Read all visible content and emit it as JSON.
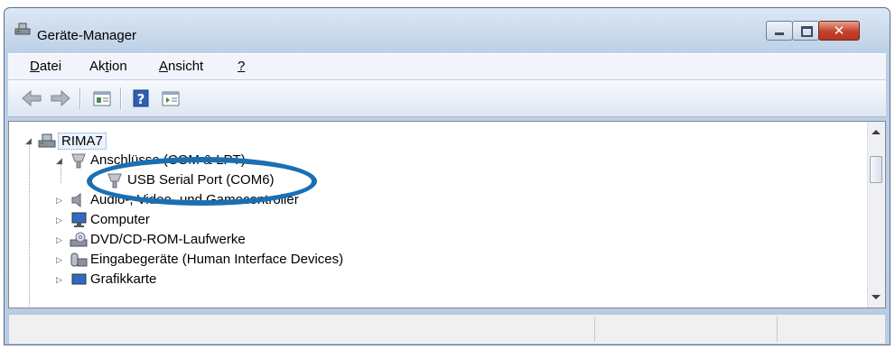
{
  "window": {
    "title": "Geräte-Manager"
  },
  "menu": [
    {
      "pre": "",
      "ul": "D",
      "post": "atei"
    },
    {
      "pre": "Ak",
      "ul": "t",
      "post": "ion"
    },
    {
      "pre": "",
      "ul": "A",
      "post": "nsicht"
    },
    {
      "pre": "",
      "ul": "?",
      "post": ""
    }
  ],
  "toolbar": {
    "back_icon": "back-arrow-icon",
    "forward_icon": "forward-arrow-icon",
    "properties_icon": "properties-icon",
    "help_icon": "help-icon",
    "console_icon": "console-tree-icon"
  },
  "tree": {
    "root": "RIMA7",
    "ports": "Anschlüsse (COM & LPT)",
    "usb_serial": "USB Serial Port (COM6)",
    "audio": "Audio-, Video- und Gamecontroller",
    "computer": "Computer",
    "dvd": "DVD/CD-ROM-Laufwerke",
    "hid": "Eingabegeräte (Human Interface Devices)",
    "graphics": "Grafikkarte"
  },
  "colors": {
    "highlight_ring": "#1a6fb3",
    "close_button": "#c3432a"
  }
}
